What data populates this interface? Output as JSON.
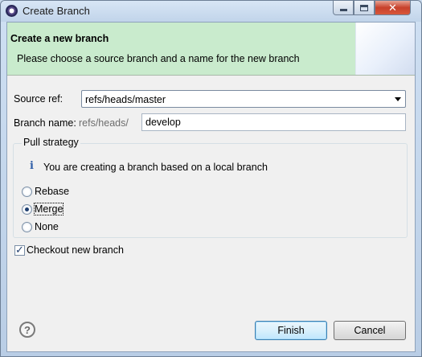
{
  "window": {
    "title": "Create Branch"
  },
  "banner": {
    "title": "Create a new branch",
    "description": "Please choose a source branch and a name for the new branch"
  },
  "form": {
    "source_label": "Source ref:",
    "source_value": "refs/heads/master",
    "branch_label": "Branch name:",
    "branch_prefix": "refs/heads/",
    "branch_value": "develop"
  },
  "pull_strategy": {
    "title": "Pull strategy",
    "info": "You are creating a branch based on a local branch",
    "options": [
      {
        "label": "Rebase",
        "checked": false
      },
      {
        "label": "Merge",
        "checked": true
      },
      {
        "label": "None",
        "checked": false
      }
    ]
  },
  "checkout": {
    "label": "Checkout new branch",
    "checked": true
  },
  "buttons": {
    "help": "?",
    "finish": "Finish",
    "cancel": "Cancel"
  },
  "icons": {
    "app": "eclipse-icon",
    "info": "info-icon",
    "help": "help-icon",
    "minimize": "minimize-icon",
    "maximize": "maximize-icon",
    "close": "close-icon"
  }
}
